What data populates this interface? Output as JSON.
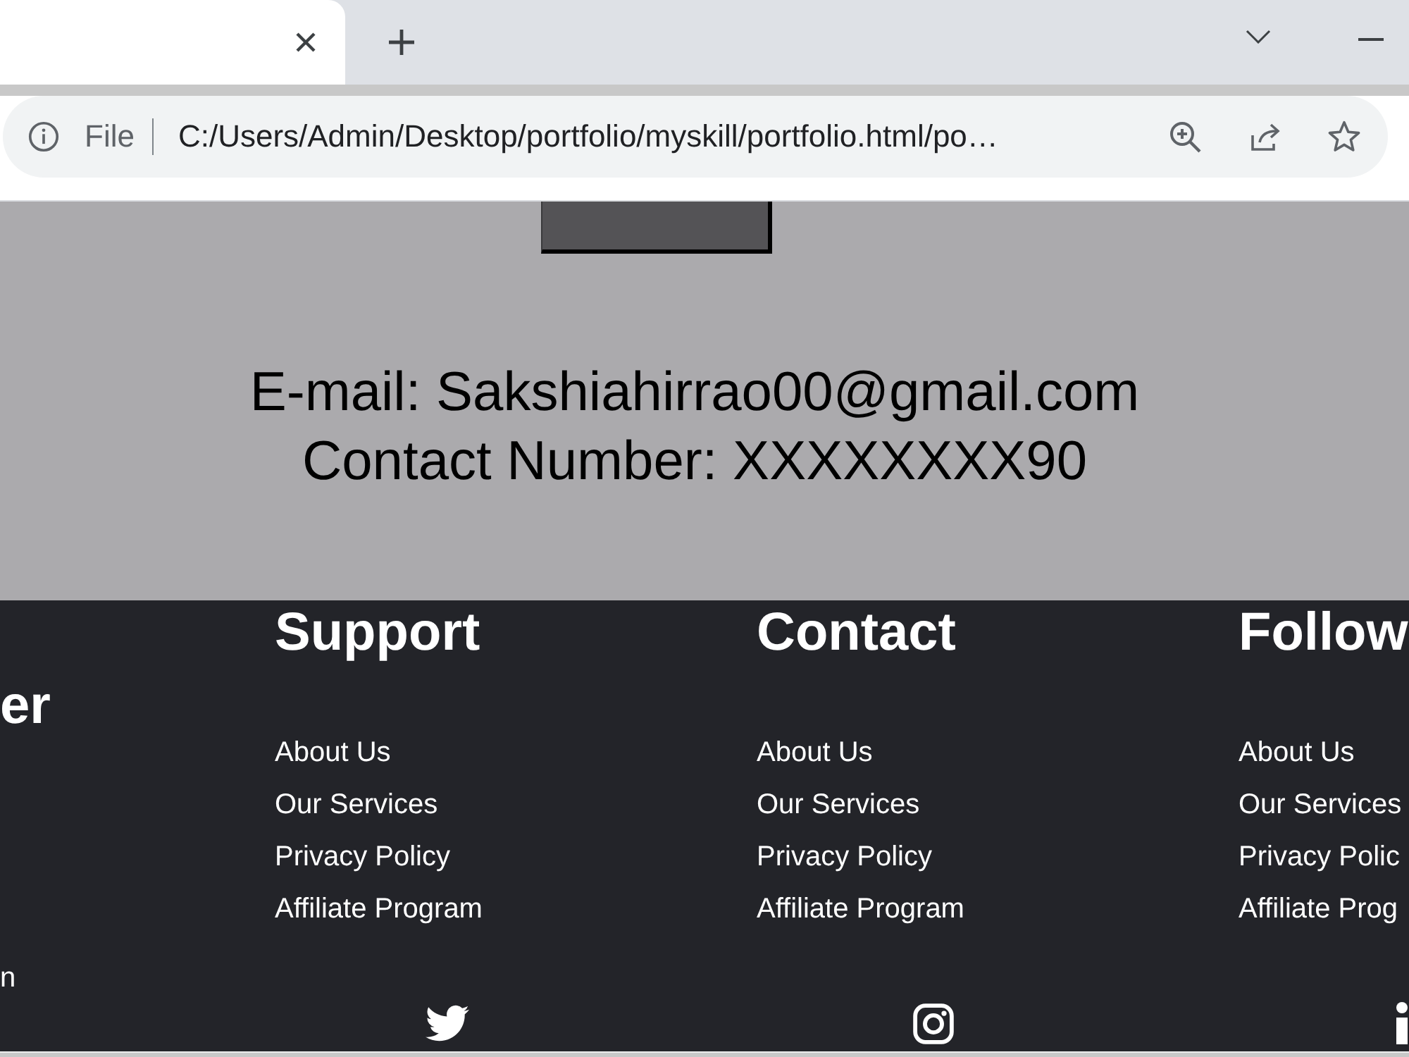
{
  "browser": {
    "address_bar": {
      "scheme": "File",
      "url": "C:/Users/Admin/Desktop/portfolio/myskill/portfolio.html/po…"
    }
  },
  "contact": {
    "email": "E-mail: Sakshiahirrao00@gmail.com",
    "phone": "Contact Number: XXXXXXXX90"
  },
  "footer": {
    "columns": [
      {
        "heading": "er",
        "note": "n"
      },
      {
        "heading": "Support",
        "links": [
          "About Us",
          "Our Services",
          "Privacy Policy",
          "Affiliate Program"
        ]
      },
      {
        "heading": "Contact",
        "links": [
          "About Us",
          "Our Services",
          "Privacy Policy",
          "Affiliate Program"
        ]
      },
      {
        "heading": "Follow",
        "links": [
          "About Us",
          "Our Services",
          "Privacy Polic",
          "Affiliate Prog"
        ]
      }
    ]
  }
}
